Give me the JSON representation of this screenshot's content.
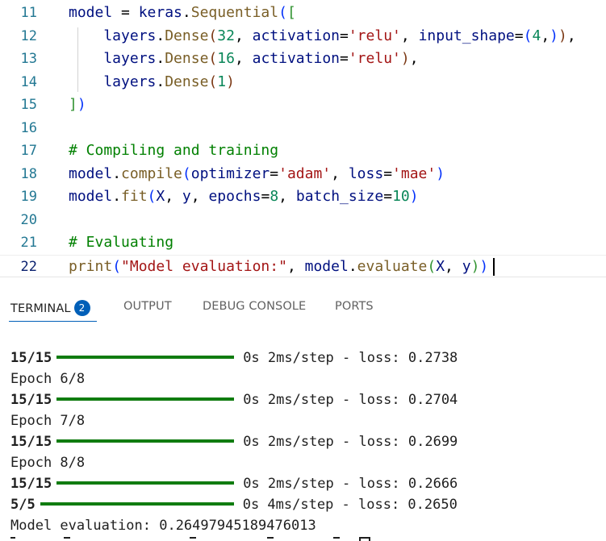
{
  "editor": {
    "lines": [
      {
        "num": "11",
        "tokens": [
          {
            "t": "model",
            "c": "tk-id"
          },
          {
            "t": " = ",
            "c": "tk-op"
          },
          {
            "t": "keras",
            "c": "tk-id"
          },
          {
            "t": ".",
            "c": "tk-op"
          },
          {
            "t": "Sequential",
            "c": "tk-fn"
          },
          {
            "t": "(",
            "c": "tk-b1"
          },
          {
            "t": "[",
            "c": "tk-b2"
          }
        ]
      },
      {
        "num": "12",
        "tokens": [
          {
            "t": "    layers",
            "c": "tk-id"
          },
          {
            "t": ".",
            "c": "tk-op"
          },
          {
            "t": "Dense",
            "c": "tk-fn"
          },
          {
            "t": "(",
            "c": "tk-b3"
          },
          {
            "t": "32",
            "c": "tk-num"
          },
          {
            "t": ", ",
            "c": "tk-op"
          },
          {
            "t": "activation",
            "c": "tk-id"
          },
          {
            "t": "=",
            "c": "tk-op"
          },
          {
            "t": "'relu'",
            "c": "tk-str"
          },
          {
            "t": ", ",
            "c": "tk-op"
          },
          {
            "t": "input_shape",
            "c": "tk-id"
          },
          {
            "t": "=",
            "c": "tk-op"
          },
          {
            "t": "(",
            "c": "tk-b1"
          },
          {
            "t": "4",
            "c": "tk-num"
          },
          {
            "t": ",",
            "c": "tk-op"
          },
          {
            "t": ")",
            "c": "tk-b1"
          },
          {
            "t": ")",
            "c": "tk-b3"
          },
          {
            "t": ",",
            "c": "tk-op"
          }
        ]
      },
      {
        "num": "13",
        "tokens": [
          {
            "t": "    layers",
            "c": "tk-id"
          },
          {
            "t": ".",
            "c": "tk-op"
          },
          {
            "t": "Dense",
            "c": "tk-fn"
          },
          {
            "t": "(",
            "c": "tk-b3"
          },
          {
            "t": "16",
            "c": "tk-num"
          },
          {
            "t": ", ",
            "c": "tk-op"
          },
          {
            "t": "activation",
            "c": "tk-id"
          },
          {
            "t": "=",
            "c": "tk-op"
          },
          {
            "t": "'relu'",
            "c": "tk-str"
          },
          {
            "t": ")",
            "c": "tk-b3"
          },
          {
            "t": ",",
            "c": "tk-op"
          }
        ]
      },
      {
        "num": "14",
        "tokens": [
          {
            "t": "    layers",
            "c": "tk-id"
          },
          {
            "t": ".",
            "c": "tk-op"
          },
          {
            "t": "Dense",
            "c": "tk-fn"
          },
          {
            "t": "(",
            "c": "tk-b3"
          },
          {
            "t": "1",
            "c": "tk-num"
          },
          {
            "t": ")",
            "c": "tk-b3"
          }
        ]
      },
      {
        "num": "15",
        "tokens": [
          {
            "t": "]",
            "c": "tk-b2"
          },
          {
            "t": ")",
            "c": "tk-b1"
          }
        ]
      },
      {
        "num": "16",
        "tokens": []
      },
      {
        "num": "17",
        "tokens": [
          {
            "t": "# Compiling and training",
            "c": "tk-cm"
          }
        ]
      },
      {
        "num": "18",
        "tokens": [
          {
            "t": "model",
            "c": "tk-id"
          },
          {
            "t": ".",
            "c": "tk-op"
          },
          {
            "t": "compile",
            "c": "tk-fn"
          },
          {
            "t": "(",
            "c": "tk-b1"
          },
          {
            "t": "optimizer",
            "c": "tk-id"
          },
          {
            "t": "=",
            "c": "tk-op"
          },
          {
            "t": "'adam'",
            "c": "tk-str"
          },
          {
            "t": ", ",
            "c": "tk-op"
          },
          {
            "t": "loss",
            "c": "tk-id"
          },
          {
            "t": "=",
            "c": "tk-op"
          },
          {
            "t": "'mae'",
            "c": "tk-str"
          },
          {
            "t": ")",
            "c": "tk-b1"
          }
        ]
      },
      {
        "num": "19",
        "tokens": [
          {
            "t": "model",
            "c": "tk-id"
          },
          {
            "t": ".",
            "c": "tk-op"
          },
          {
            "t": "fit",
            "c": "tk-fn"
          },
          {
            "t": "(",
            "c": "tk-b1"
          },
          {
            "t": "X",
            "c": "tk-id"
          },
          {
            "t": ", ",
            "c": "tk-op"
          },
          {
            "t": "y",
            "c": "tk-id"
          },
          {
            "t": ", ",
            "c": "tk-op"
          },
          {
            "t": "epochs",
            "c": "tk-id"
          },
          {
            "t": "=",
            "c": "tk-op"
          },
          {
            "t": "8",
            "c": "tk-num"
          },
          {
            "t": ", ",
            "c": "tk-op"
          },
          {
            "t": "batch_size",
            "c": "tk-id"
          },
          {
            "t": "=",
            "c": "tk-op"
          },
          {
            "t": "10",
            "c": "tk-num"
          },
          {
            "t": ")",
            "c": "tk-b1"
          }
        ]
      },
      {
        "num": "20",
        "tokens": []
      },
      {
        "num": "21",
        "tokens": [
          {
            "t": "# Evaluating",
            "c": "tk-cm"
          }
        ]
      },
      {
        "num": "22",
        "tokens": [
          {
            "t": "print",
            "c": "tk-fn"
          },
          {
            "t": "(",
            "c": "tk-b1"
          },
          {
            "t": "\"Model evaluation:\"",
            "c": "tk-str"
          },
          {
            "t": ", ",
            "c": "tk-op"
          },
          {
            "t": "model",
            "c": "tk-id"
          },
          {
            "t": ".",
            "c": "tk-op"
          },
          {
            "t": "evaluate",
            "c": "tk-fn"
          },
          {
            "t": "(",
            "c": "tk-b2"
          },
          {
            "t": "X",
            "c": "tk-id"
          },
          {
            "t": ", ",
            "c": "tk-op"
          },
          {
            "t": "y",
            "c": "tk-id"
          },
          {
            "t": ")",
            "c": "tk-b2"
          },
          {
            "t": ")",
            "c": "tk-b1"
          }
        ]
      }
    ],
    "active_line": "22"
  },
  "panel": {
    "tabs": {
      "terminal": "TERMINAL",
      "terminal_badge": "2",
      "output": "OUTPUT",
      "debug_console": "DEBUG CONSOLE",
      "ports": "PORTS"
    },
    "active_tab": "TERMINAL"
  },
  "terminal": {
    "lines": [
      {
        "kind": "progress",
        "steps": "15/15",
        "time": "0s 2ms/step - loss: 0.2738"
      },
      {
        "kind": "text",
        "text": "Epoch 6/8"
      },
      {
        "kind": "progress",
        "steps": "15/15",
        "time": "0s 2ms/step - loss: 0.2704"
      },
      {
        "kind": "text",
        "text": "Epoch 7/8"
      },
      {
        "kind": "progress",
        "steps": "15/15",
        "time": "0s 2ms/step - loss: 0.2699"
      },
      {
        "kind": "text",
        "text": "Epoch 8/8"
      },
      {
        "kind": "progress",
        "steps": "15/15",
        "time": "0s 2ms/step - loss: 0.2666"
      },
      {
        "kind": "progress",
        "steps": "5/5",
        "time": "0s 4ms/step - loss: 0.2650"
      },
      {
        "kind": "text",
        "text": "Model evaluation: 0.26497945189476013"
      }
    ],
    "progress_fraction": 1.0
  },
  "colors": {
    "progress_green": "#107c10",
    "badge_blue": "#005fb8",
    "line_number": "#237893",
    "comment_green": "#008000",
    "string_red": "#a31515"
  }
}
